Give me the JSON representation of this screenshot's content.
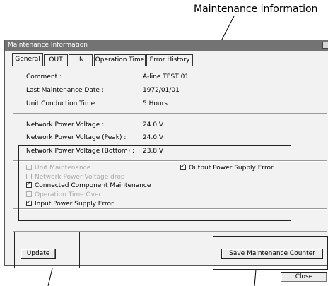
{
  "callout": {
    "label": "Maintenance information"
  },
  "window": {
    "title": "Maintenance Information",
    "close_glyph": "×"
  },
  "tabs": [
    {
      "label": "General",
      "active": true
    },
    {
      "label": "OUT",
      "active": false
    },
    {
      "label": "IN",
      "active": false
    },
    {
      "label": "Operation Time",
      "active": false
    },
    {
      "label": "Error History",
      "active": false
    }
  ],
  "info": {
    "comment_label": "Comment :",
    "comment_value": "A-line TEST 01",
    "last_date_label": "Last Maintenance Date :",
    "last_date_value": "1972/01/01",
    "conduction_label": "Unit Conduction Time :",
    "conduction_value": "5 Hours"
  },
  "voltages": {
    "nominal_label": "Network Power Voltage :",
    "nominal_value": "24.0 V",
    "peak_label": "Network Power Voltage (Peak) :",
    "peak_value": "24.0 V",
    "bottom_label": "Network Power Voltage (Bottom) :",
    "bottom_value": "23.8 V"
  },
  "flags": {
    "unit_maintenance": {
      "label": "Unit Maintenance",
      "checked": false,
      "enabled": false
    },
    "voltage_drop": {
      "label": "Network Power Voltage drop",
      "checked": false,
      "enabled": false
    },
    "connected_maintenance": {
      "label": "Connected Component Maintenance",
      "checked": true,
      "enabled": true
    },
    "operation_time_over": {
      "label": "Operation Time Over",
      "checked": false,
      "enabled": false
    },
    "input_supply_error": {
      "label": "Input Power Supply Error",
      "checked": true,
      "enabled": true
    },
    "output_supply_error": {
      "label": "Output Power Supply Error",
      "checked": true,
      "enabled": true
    }
  },
  "buttons": {
    "update": "Update",
    "save_counter": "Save Maintenance Counter",
    "close": "Close"
  }
}
